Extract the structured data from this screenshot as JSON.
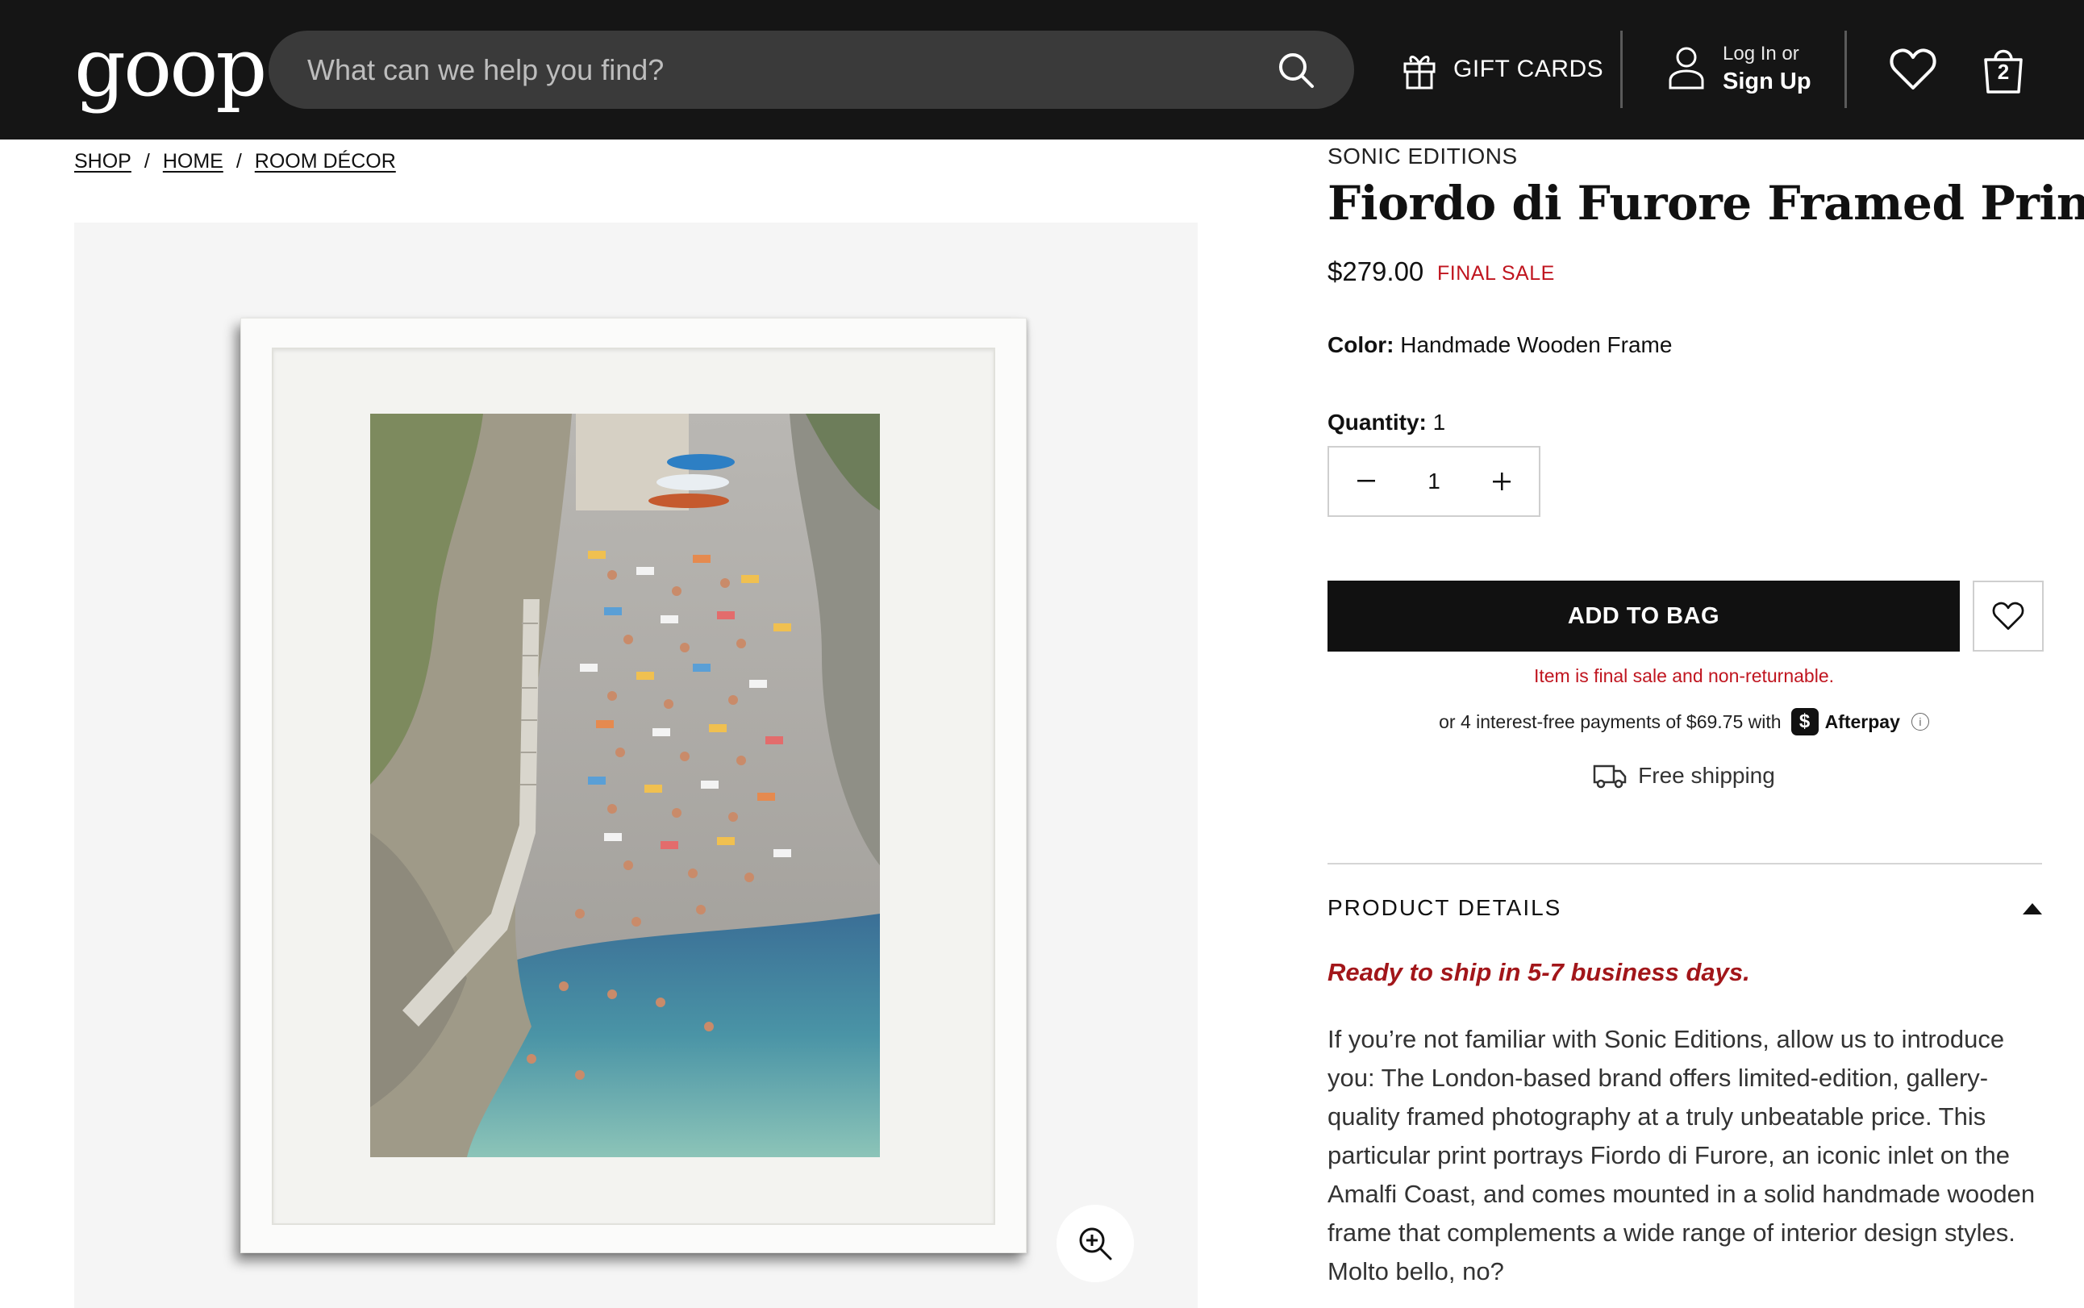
{
  "header": {
    "logo": "goop",
    "search_placeholder": "What can we help you find?",
    "gift_cards": "GIFT CARDS",
    "login_line1": "Log In or",
    "login_line2": "Sign Up",
    "bag_count": "2"
  },
  "breadcrumb": [
    {
      "label": "SHOP"
    },
    {
      "label": "HOME"
    },
    {
      "label": "ROOM DÉCOR"
    }
  ],
  "breadcrumb_sep": "/",
  "product": {
    "brand": "SONIC EDITIONS",
    "title": "Fiordo di Furore Framed Print",
    "price": "$279.00",
    "final_sale": "FINAL SALE",
    "color_label": "Color:",
    "color_value": "Handmade Wooden Frame",
    "quantity_label": "Quantity:",
    "quantity_value": "1",
    "stepper_value": "1",
    "add_to_bag": "ADD TO BAG",
    "final_sale_notice": "Item is final sale and non-returnable.",
    "afterpay_text": "or 4 interest-free payments of $69.75 with",
    "afterpay_badge": "$",
    "afterpay_name": "Afterpay",
    "shipping": "Free shipping",
    "details_heading": "PRODUCT DETAILS",
    "ready_to_ship": "Ready to ship in 5-7 business days.",
    "description": "If you’re not familiar with Sonic Editions, allow us to introduce you: The London-based brand offers limited-edition, gallery-quality framed photography at a truly unbeatable price. This particular print portrays Fiordo di Furore, an iconic inlet on the Amalfi Coast, and comes mounted in a solid handmade wooden frame that complements a wide range of interior design styles. Molto bello, no?"
  },
  "colors": {
    "header_bg": "#151515",
    "search_bg": "#3a3a3a",
    "sale_red": "#c0151f",
    "ready_red": "#a2161a",
    "button_black": "#111111"
  }
}
